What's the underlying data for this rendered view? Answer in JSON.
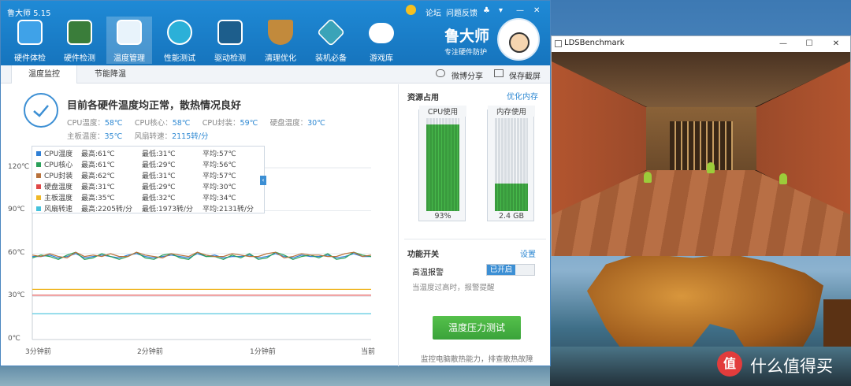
{
  "app": {
    "title": "鲁大师 5.15",
    "header_links": [
      "论坛",
      "问题反馈"
    ],
    "toolbar": [
      {
        "label": "硬件体检",
        "icon": "hardware-check-icon"
      },
      {
        "label": "硬件检测",
        "icon": "hardware-detect-icon"
      },
      {
        "label": "温度管理",
        "icon": "temperature-icon"
      },
      {
        "label": "性能测试",
        "icon": "performance-icon"
      },
      {
        "label": "驱动检测",
        "icon": "driver-icon"
      },
      {
        "label": "清理优化",
        "icon": "broom-icon"
      },
      {
        "label": "装机必备",
        "icon": "install-icon"
      },
      {
        "label": "游戏库",
        "icon": "gamepad-icon"
      }
    ],
    "brand": {
      "name": "鲁大师",
      "slogan": "专注硬件防护"
    },
    "tabs": [
      "温度监控",
      "节能降温"
    ],
    "actions": {
      "weibo": "微博分享",
      "screenshot": "保存截屏"
    },
    "status": {
      "message": "目前各硬件温度均正常，散热情况良好",
      "readings": [
        {
          "label": "CPU温度：",
          "value": "58℃"
        },
        {
          "label": "CPU核心：",
          "value": "58℃"
        },
        {
          "label": "CPU封装：",
          "value": "59℃"
        },
        {
          "label": "硬盘温度：",
          "value": "30℃"
        },
        {
          "label": "主板温度：",
          "value": "35℃"
        },
        {
          "label": "风扇转速：",
          "value": "2115转/分"
        }
      ]
    },
    "legend": [
      {
        "name": "CPU温度",
        "max": "最高:61℃",
        "min": "最低:31℃",
        "avg": "平均:57℃",
        "color": "#2f7fd6"
      },
      {
        "name": "CPU核心",
        "max": "最高:61℃",
        "min": "最低:29℃",
        "avg": "平均:56℃",
        "color": "#2aa05a"
      },
      {
        "name": "CPU封装",
        "max": "最高:62℃",
        "min": "最低:31℃",
        "avg": "平均:57℃",
        "color": "#b8723c"
      },
      {
        "name": "硬盘温度",
        "max": "最高:31℃",
        "min": "最低:29℃",
        "avg": "平均:30℃",
        "color": "#e04848"
      },
      {
        "name": "主板温度",
        "max": "最高:35℃",
        "min": "最低:32℃",
        "avg": "平均:34℃",
        "color": "#f0b828"
      },
      {
        "name": "风扇转速",
        "max": "最高:2205转/分",
        "min": "最低:1973转/分",
        "avg": "平均:2131转/分",
        "color": "#45c2dc"
      }
    ],
    "chart_data": {
      "type": "line",
      "y_ticks": [
        "120℃",
        "90℃",
        "60℃",
        "30℃",
        "0℃"
      ],
      "x_ticks": [
        "3分钟前",
        "2分钟前",
        "1分钟前",
        "当前"
      ],
      "ylim": [
        0,
        120
      ],
      "series": [
        {
          "name": "CPU温度",
          "color": "#2f7fd6",
          "values": [
            58,
            58,
            59,
            57,
            58,
            60,
            57,
            58,
            59,
            58,
            57,
            59,
            60,
            58,
            57,
            58,
            59,
            58,
            57,
            60,
            58,
            59,
            57,
            58,
            58,
            59,
            57,
            58,
            60,
            58,
            57,
            59,
            58,
            58,
            59,
            57,
            58,
            60,
            58,
            58
          ]
        },
        {
          "name": "CPU核心",
          "color": "#2aa05a",
          "values": [
            57,
            59,
            58,
            56,
            59,
            61,
            56,
            57,
            60,
            58,
            56,
            58,
            61,
            57,
            56,
            59,
            60,
            57,
            56,
            61,
            58,
            58,
            56,
            59,
            57,
            60,
            56,
            57,
            61,
            59,
            56,
            58,
            59,
            57,
            60,
            56,
            57,
            61,
            59,
            58
          ]
        },
        {
          "name": "CPU封装",
          "color": "#b8723c",
          "values": [
            59,
            58,
            60,
            58,
            57,
            61,
            58,
            59,
            58,
            60,
            58,
            58,
            61,
            59,
            58,
            57,
            60,
            59,
            58,
            61,
            59,
            58,
            58,
            60,
            59,
            58,
            58,
            60,
            61,
            57,
            58,
            60,
            59,
            59,
            58,
            58,
            60,
            61,
            58,
            59
          ]
        },
        {
          "name": "主板温度",
          "color": "#f0b828",
          "values": [
            35,
            35,
            35,
            35,
            35,
            35,
            35,
            35,
            35,
            35,
            35,
            35,
            35,
            35,
            35,
            35,
            35,
            35,
            35,
            35,
            35,
            35,
            35,
            35,
            35,
            35,
            35,
            35,
            35,
            35,
            35,
            35,
            35,
            35,
            35,
            35,
            35,
            35,
            35,
            35
          ]
        },
        {
          "name": "硬盘温度",
          "color": "#e04848",
          "values": [
            31,
            31,
            31,
            31,
            31,
            31,
            31,
            31,
            31,
            31,
            31,
            31,
            31,
            31,
            31,
            31,
            31,
            31,
            31,
            31,
            31,
            31,
            31,
            31,
            31,
            31,
            31,
            31,
            31,
            31,
            31,
            31,
            31,
            31,
            31,
            31,
            31,
            31,
            31,
            31
          ]
        },
        {
          "name": "风扇转速",
          "color": "#45c2dc",
          "values": [
            18,
            18,
            18,
            18,
            18,
            18,
            18,
            18,
            18,
            18,
            18,
            18,
            18,
            18,
            18,
            18,
            18,
            18,
            18,
            18,
            18,
            18,
            18,
            18,
            18,
            18,
            18,
            18,
            18,
            18,
            18,
            18,
            18,
            18,
            18,
            18,
            18,
            18,
            18,
            18
          ]
        }
      ]
    },
    "resources": {
      "title": "资源占用",
      "optimize_link": "优化内存",
      "cpu": {
        "label": "CPU使用",
        "value": "93%",
        "fraction": 0.93
      },
      "memory": {
        "label": "内存使用",
        "value": "2.4 GB",
        "fraction": 0.3
      }
    },
    "features": {
      "title": "功能开关",
      "settings_link": "设置",
      "switch_label": "高温报警",
      "switch_state": "已开启",
      "switch_desc": "当温度过高时，报警提醒"
    },
    "stress": {
      "button": "温度压力测试",
      "desc": "监控电脑散热能力，排查散热故障"
    }
  },
  "lds": {
    "title": "LDSBenchmark",
    "controls": [
      "—",
      "☐",
      "✕"
    ]
  },
  "app_controls": [
    "—",
    "✕"
  ],
  "watermark": {
    "logo": "值",
    "text": "什么值得买"
  }
}
